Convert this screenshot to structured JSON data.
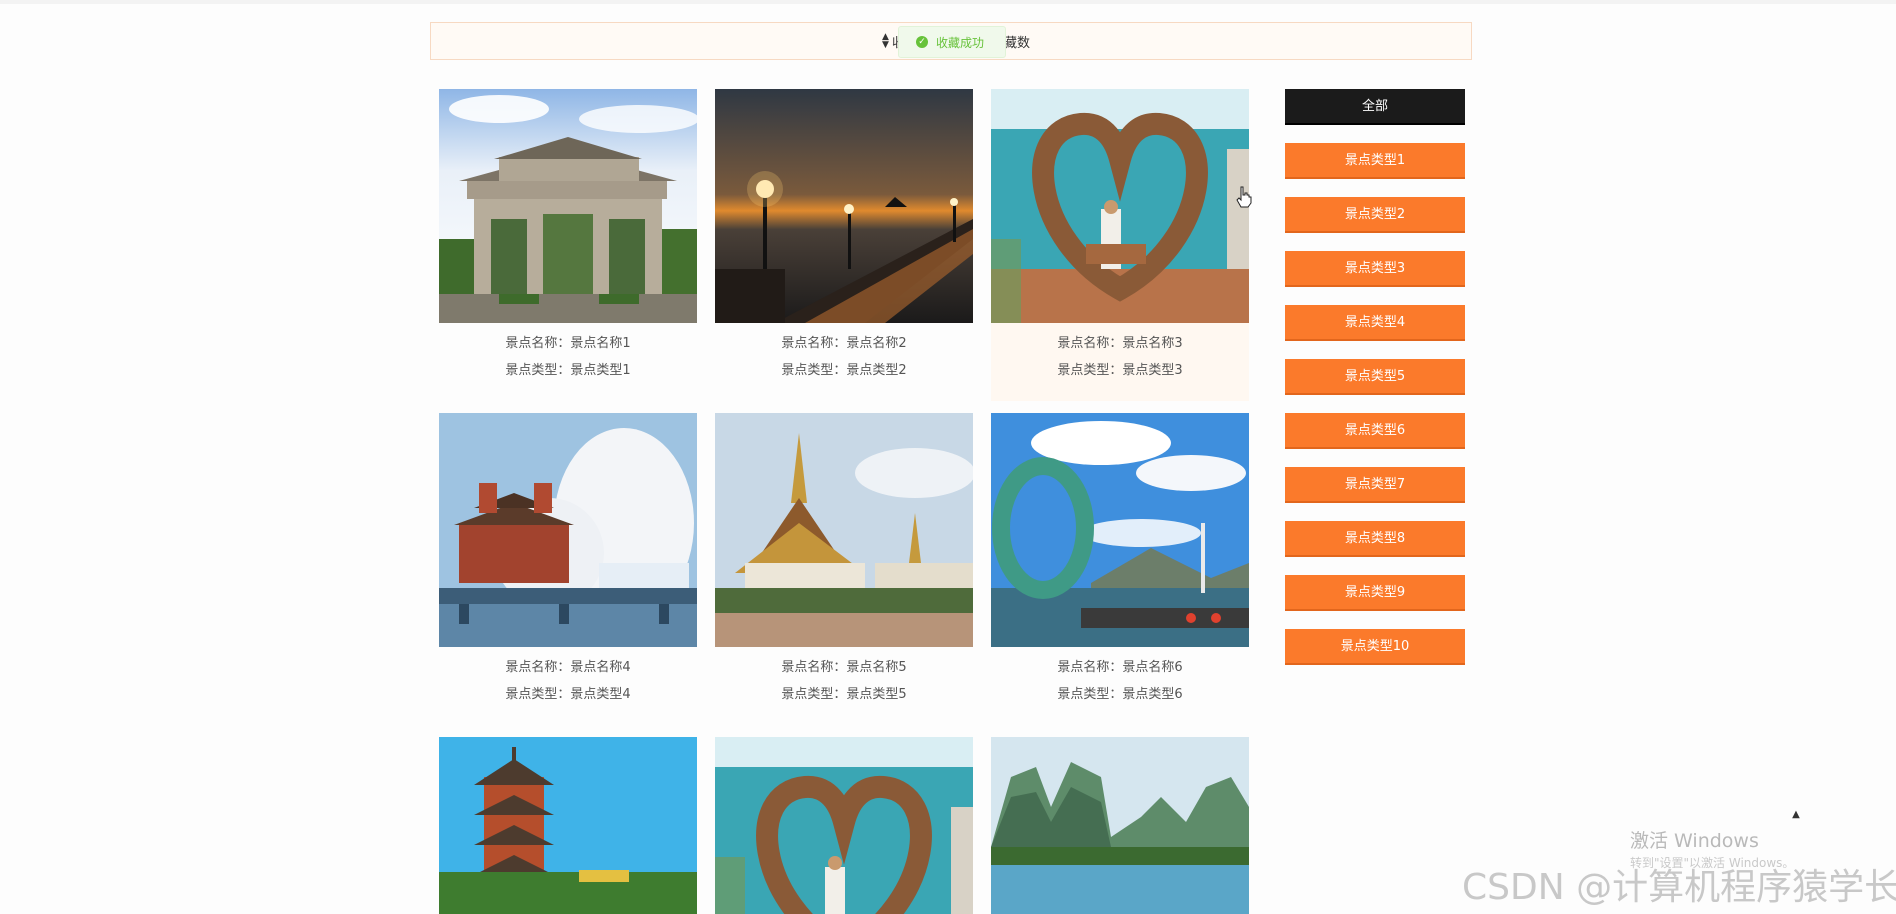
{
  "sort_bar": {
    "label_left": "收",
    "label_right": "藏数",
    "sort_icon": "sort-updown-icon"
  },
  "toast": {
    "text": "收藏成功",
    "icon": "check-circle-icon",
    "color": "#67c23a"
  },
  "cards": [
    {
      "name_line": "景点名称：景点名称1",
      "type_line": "景点类型：景点类型1",
      "image": "stone-archway"
    },
    {
      "name_line": "景点名称：景点名称2",
      "type_line": "景点类型：景点类型2",
      "image": "sunset-pier"
    },
    {
      "name_line": "景点名称：景点名称3",
      "type_line": "景点类型：景点类型3",
      "image": "heart-nest-sea"
    },
    {
      "name_line": "景点名称：景点名称4",
      "type_line": "景点类型：景点类型4",
      "image": "opera-house-pavilion"
    },
    {
      "name_line": "景点名称：景点名称5",
      "type_line": "景点类型：景点类型5",
      "image": "thai-temple"
    },
    {
      "name_line": "景点名称：景点名称6",
      "type_line": "景点类型：景点类型6",
      "image": "ring-sculpture-sea"
    },
    {
      "name_line": "",
      "type_line": "",
      "image": "pagoda-tower"
    },
    {
      "name_line": "",
      "type_line": "",
      "image": "heart-nest-sea"
    },
    {
      "name_line": "",
      "type_line": "",
      "image": "karst-river"
    }
  ],
  "categories": [
    "全部",
    "景点类型1",
    "景点类型2",
    "景点类型3",
    "景点类型4",
    "景点类型5",
    "景点类型6",
    "景点类型7",
    "景点类型8",
    "景点类型9",
    "景点类型10"
  ],
  "colors": {
    "accent": "#fb7a2b",
    "active_category": "#1b1b1b"
  },
  "back_to_top_icon": "caret-up-icon",
  "windows_activation": {
    "title": "激活 Windows",
    "subtitle": "转到\"设置\"以激活 Windows。"
  },
  "watermark": "CSDN @计算机程序猿学长"
}
